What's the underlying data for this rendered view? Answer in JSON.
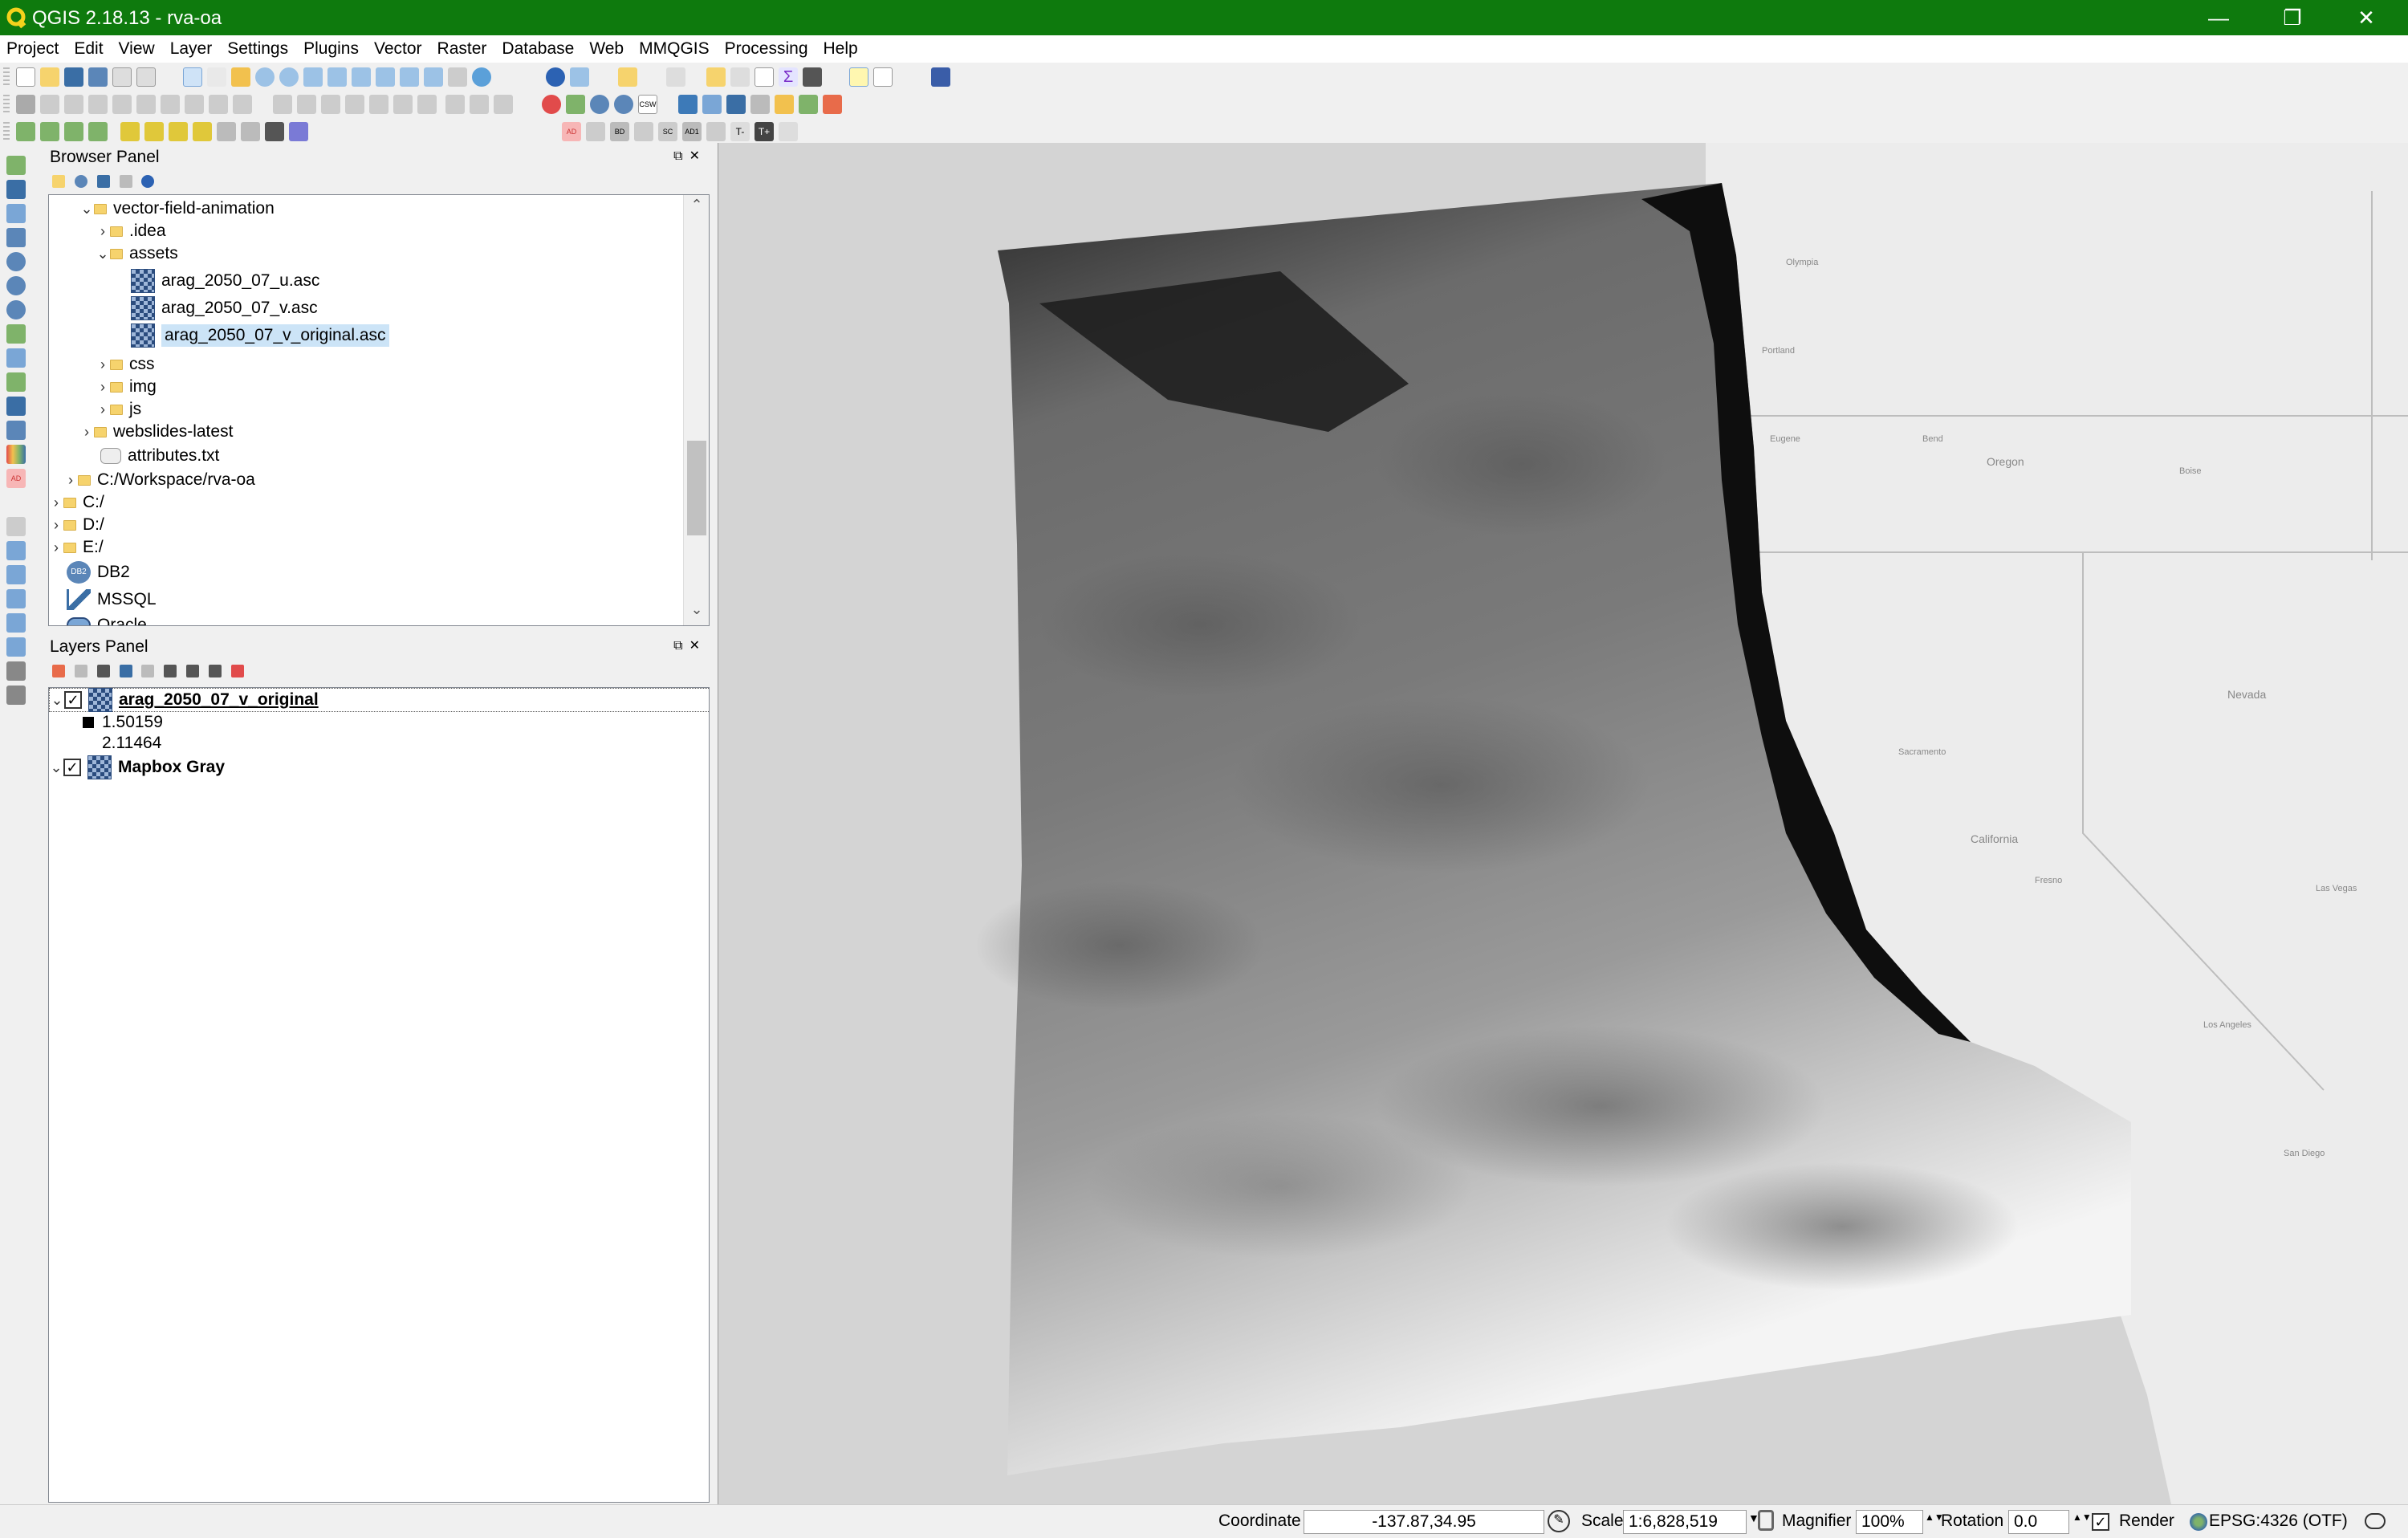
{
  "window": {
    "title": "QGIS 2.18.13 - rva-oa",
    "controls": {
      "minimize": "—",
      "restore": "❐",
      "close": "✕"
    }
  },
  "menu": [
    "Project",
    "Edit",
    "View",
    "Layer",
    "Settings",
    "Plugins",
    "Vector",
    "Raster",
    "Database",
    "Web",
    "MMQGIS",
    "Processing",
    "Help"
  ],
  "browser_panel": {
    "title": "Browser Panel",
    "items": [
      {
        "label": "vector-field-animation",
        "type": "folder",
        "expanded": true
      },
      {
        "label": ".idea",
        "type": "folder",
        "expanded": false
      },
      {
        "label": "assets",
        "type": "folder",
        "expanded": true
      },
      {
        "label": "arag_2050_07_u.asc",
        "type": "raster"
      },
      {
        "label": "arag_2050_07_v.asc",
        "type": "raster"
      },
      {
        "label": "arag_2050_07_v_original.asc",
        "type": "raster",
        "selected": true
      },
      {
        "label": "css",
        "type": "folder",
        "expanded": false
      },
      {
        "label": "img",
        "type": "folder",
        "expanded": false
      },
      {
        "label": "js",
        "type": "folder",
        "expanded": false
      },
      {
        "label": "webslides-latest",
        "type": "folder",
        "expanded": false
      },
      {
        "label": "attributes.txt",
        "type": "file"
      },
      {
        "label": "C:/Workspace/rva-oa",
        "type": "folder",
        "expanded": false
      },
      {
        "label": "C:/",
        "type": "drive"
      },
      {
        "label": "D:/",
        "type": "drive"
      },
      {
        "label": "E:/",
        "type": "drive"
      },
      {
        "label": "DB2",
        "type": "db2"
      },
      {
        "label": "MSSQL",
        "type": "mssql"
      },
      {
        "label": "Oracle",
        "type": "oracle"
      }
    ]
  },
  "layers_panel": {
    "title": "Layers Panel",
    "layers": [
      {
        "name": "arag_2050_07_v_original",
        "checked": true,
        "legend_min": "1.50159",
        "legend_max": "2.11464"
      },
      {
        "name": "Mapbox Gray",
        "checked": true
      }
    ]
  },
  "status": {
    "coordinate_label": "Coordinate",
    "coordinate_value": "-137.87,34.95",
    "scale_label": "Scale",
    "scale_value": "1:6,828,519",
    "magnifier_label": "Magnifier",
    "magnifier_value": "100%",
    "rotation_label": "Rotation",
    "rotation_value": "0.0",
    "render_label": "Render",
    "crs_label": "EPSG:4326 (OTF)"
  },
  "map_labels": [
    "Olympia",
    "Portland",
    "Eugene",
    "Bend",
    "Oregon",
    "Boise",
    "Sacramento",
    "California",
    "Nevada",
    "Fresno",
    "Las Vegas",
    "Los Angeles",
    "San Diego"
  ],
  "colors": {
    "titlebar": "#0e7a0d",
    "selection": "#cce4f7",
    "panel_bg": "#f0f0f0"
  }
}
